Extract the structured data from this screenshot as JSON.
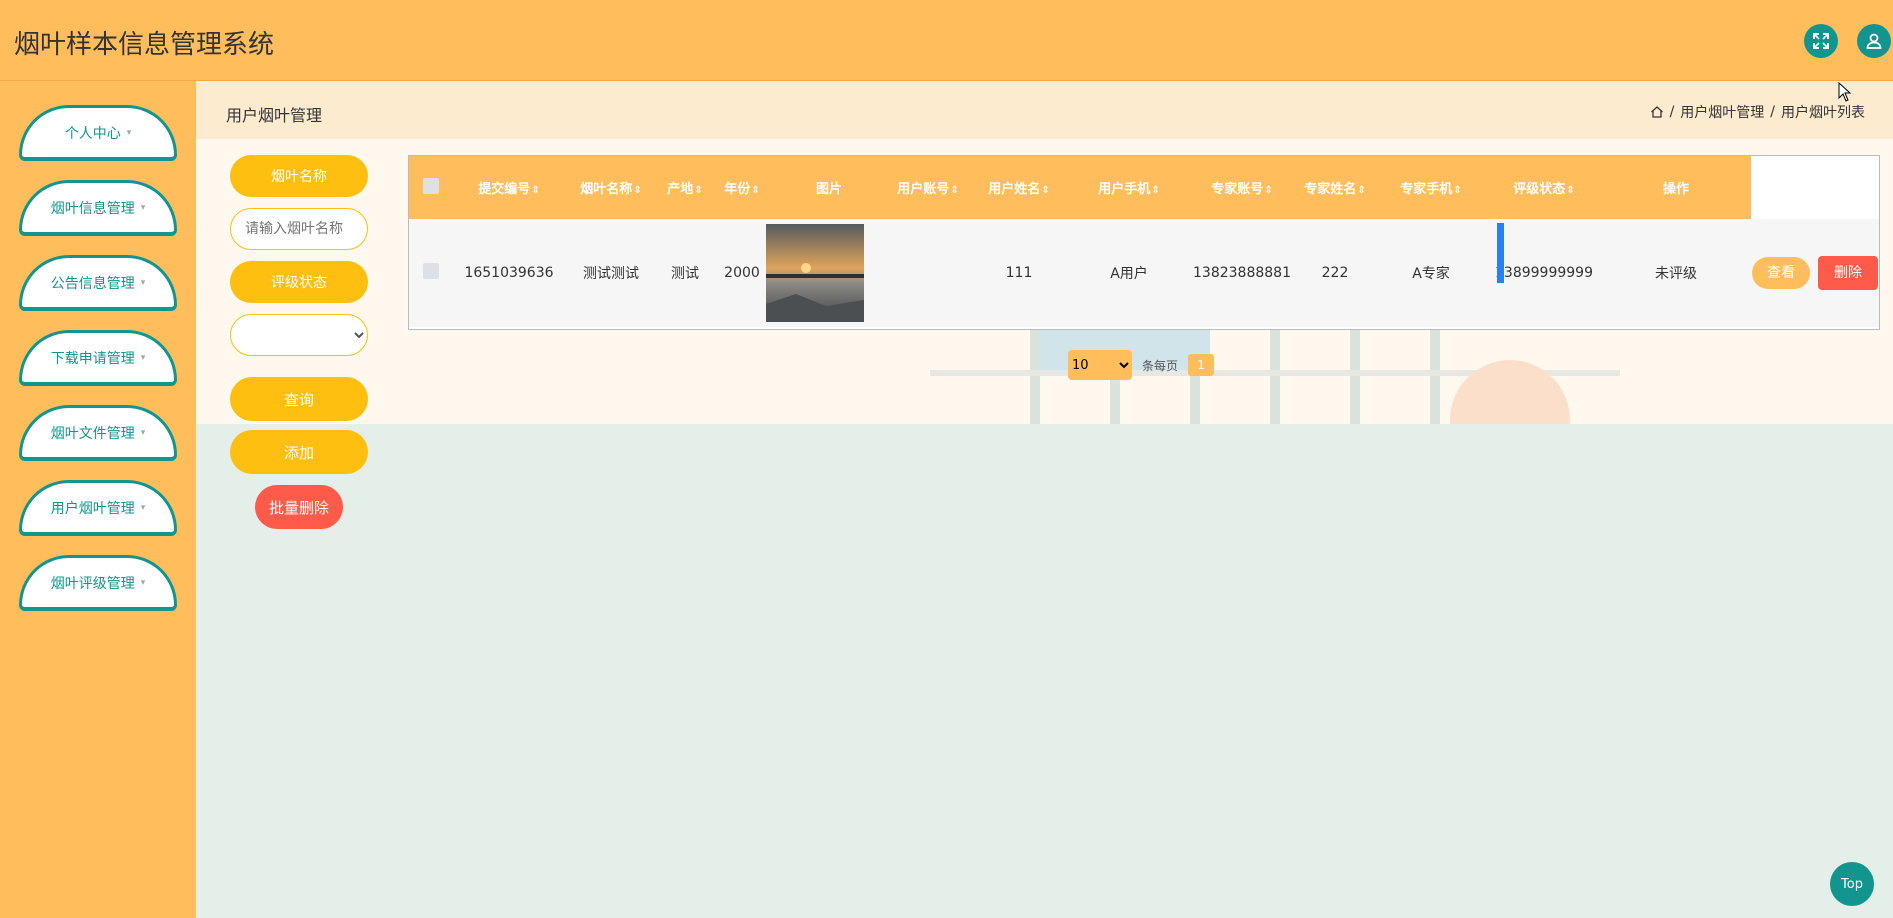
{
  "app_title": "烟叶样本信息管理系统",
  "header": {
    "fullscreen_icon": "fullscreen-icon",
    "user_icon": "user-icon"
  },
  "sidebar": {
    "items": [
      {
        "label": "个人中心"
      },
      {
        "label": "烟叶信息管理"
      },
      {
        "label": "公告信息管理"
      },
      {
        "label": "下载申请管理"
      },
      {
        "label": "烟叶文件管理"
      },
      {
        "label": "用户烟叶管理"
      },
      {
        "label": "烟叶评级管理"
      }
    ],
    "caret": "▾"
  },
  "page": {
    "heading": "用户烟叶管理",
    "breadcrumb": [
      "用户烟叶管理",
      "用户烟叶列表"
    ],
    "separator": "/"
  },
  "filters": {
    "name_label": "烟叶名称",
    "name_placeholder": "请输入烟叶名称",
    "status_label": "评级状态",
    "query_button": "查询",
    "add_button": "添加",
    "batch_delete_button": "批量删除"
  },
  "table": {
    "headers": [
      "提交编号",
      "烟叶名称",
      "产地",
      "年份",
      "图片",
      "用户账号",
      "用户姓名",
      "用户手机",
      "专家账号",
      "专家姓名",
      "专家手机",
      "评级状态",
      "操作"
    ],
    "sortable": [
      true,
      true,
      true,
      true,
      false,
      true,
      true,
      true,
      true,
      true,
      true,
      true,
      false
    ],
    "rows": [
      {
        "submit_no": "1651039636",
        "name": "测试测试",
        "origin": "测试",
        "year": "2000",
        "user_account": "111",
        "user_name": "A用户",
        "user_phone": "13823888881",
        "expert_account": "222",
        "expert_name": "A专家",
        "expert_phone": "13899999999",
        "status": "未评级"
      }
    ],
    "view_label": "查看",
    "delete_label": "删除"
  },
  "pagination": {
    "page_size": "10",
    "per_page_label": "条每页",
    "current_page": "1"
  },
  "back_to_top": "Top",
  "colors": {
    "primary": "#ffbe5b",
    "teal": "#13958f",
    "yellow": "#ffbf10",
    "red": "#ff5a4a"
  }
}
